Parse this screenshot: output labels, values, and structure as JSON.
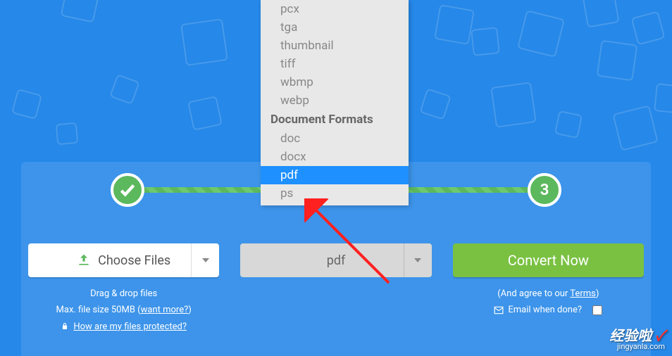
{
  "dropdown": {
    "image_items": [
      "pcx",
      "tga",
      "thumbnail",
      "tiff",
      "wbmp",
      "webp"
    ],
    "doc_header": "Document Formats",
    "doc_items": [
      "doc",
      "docx",
      "pdf",
      "ps"
    ],
    "selected": "pdf"
  },
  "steps": {
    "step3": "3"
  },
  "choose": {
    "label": "Choose Files"
  },
  "format": {
    "selected": "pdf"
  },
  "convert": {
    "label": "Convert Now"
  },
  "sub1": {
    "line1": "Drag & drop files",
    "line2_prefix": "Max. file size 50MB (",
    "line2_link": "want more?",
    "line2_suffix": ")",
    "line3": "How are my files protected?"
  },
  "sub3": {
    "agree_prefix": "(And agree to our ",
    "agree_link": "Terms",
    "agree_suffix": ")",
    "email": "Email when done?"
  },
  "watermark": {
    "main": "经验啦",
    "check": "✓",
    "url": "jingyanla.com"
  }
}
